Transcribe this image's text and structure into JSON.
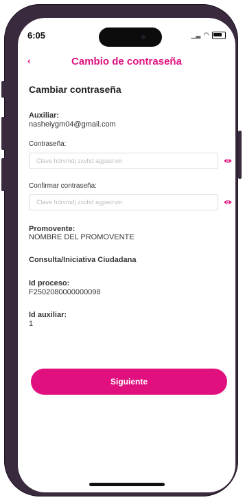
{
  "status": {
    "time": "6:05"
  },
  "header": {
    "title": "Cambio de contraseña"
  },
  "form": {
    "section_title": "Cambiar contraseña",
    "auxiliar_label": "Auxiliar:",
    "auxiliar_value": "nasheiygm04@gmail.com",
    "password_label": "Contraseña:",
    "password_placeholder": "Clave hdrvmdj zxvhd agpacrvm",
    "confirm_label": "Confirmar contraseña:",
    "confirm_placeholder": "Clave hdrvmdj zxvhd agpacrvm",
    "promovente_label": "Promovente:",
    "promovente_value": "NOMBRE DEL PROMOVENTE",
    "consulta_label": "Consulta/Iniciativa Ciudadana",
    "proceso_label": "Id proceso:",
    "proceso_value": "F2502080000000098",
    "auxiliar_id_label": "Id auxiliar:",
    "auxiliar_id_value": "1"
  },
  "actions": {
    "next": "Siguiente"
  },
  "colors": {
    "accent": "#e0117f"
  }
}
